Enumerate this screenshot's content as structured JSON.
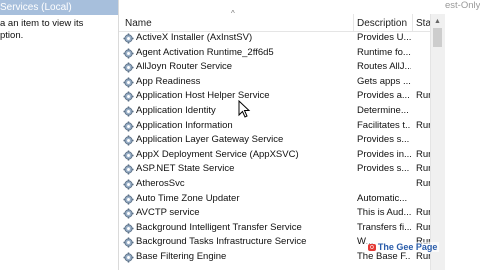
{
  "left_pane": {
    "header": "Services (Local)",
    "text_line1": "a an item to view its",
    "text_line2": "ption."
  },
  "header": {
    "name": "Name",
    "description": "Description",
    "status": "Sta"
  },
  "right_strip": {
    "text": "est-Only"
  },
  "services": [
    {
      "name": "ActiveX Installer (AxInstSV)",
      "description": "Provides U...",
      "status": ""
    },
    {
      "name": "Agent Activation Runtime_2ff6d5",
      "description": "Runtime fo...",
      "status": ""
    },
    {
      "name": "AllJoyn Router Service",
      "description": "Routes AllJ...",
      "status": ""
    },
    {
      "name": "App Readiness",
      "description": "Gets apps ...",
      "status": ""
    },
    {
      "name": "Application Host Helper Service",
      "description": "Provides a...",
      "status": "Rur"
    },
    {
      "name": "Application Identity",
      "description": "Determine...",
      "status": ""
    },
    {
      "name": "Application Information",
      "description": "Facilitates t...",
      "status": "Rur"
    },
    {
      "name": "Application Layer Gateway Service",
      "description": "Provides s...",
      "status": ""
    },
    {
      "name": "AppX Deployment Service (AppXSVC)",
      "description": "Provides in...",
      "status": "Rur"
    },
    {
      "name": "ASP.NET State Service",
      "description": "Provides s...",
      "status": "Rur"
    },
    {
      "name": "AtherosSvc",
      "description": "",
      "status": "Rur"
    },
    {
      "name": "Auto Time Zone Updater",
      "description": "Automatic...",
      "status": ""
    },
    {
      "name": "AVCTP service",
      "description": "This is Aud...",
      "status": "Rur"
    },
    {
      "name": "Background Intelligent Transfer Service",
      "description": "Transfers fi...",
      "status": "Rur"
    },
    {
      "name": "Background Tasks Infrastructure Service",
      "description": "W...",
      "status": "Rur"
    },
    {
      "name": "Base Filtering Engine",
      "description": "The Base F...",
      "status": "Rur"
    }
  ],
  "watermark": {
    "badge": "o",
    "text": "The Gee Page"
  },
  "colors": {
    "header_bg": "#a7bfdc",
    "text": "#111111",
    "scroll_thumb": "#cdcdcd"
  }
}
